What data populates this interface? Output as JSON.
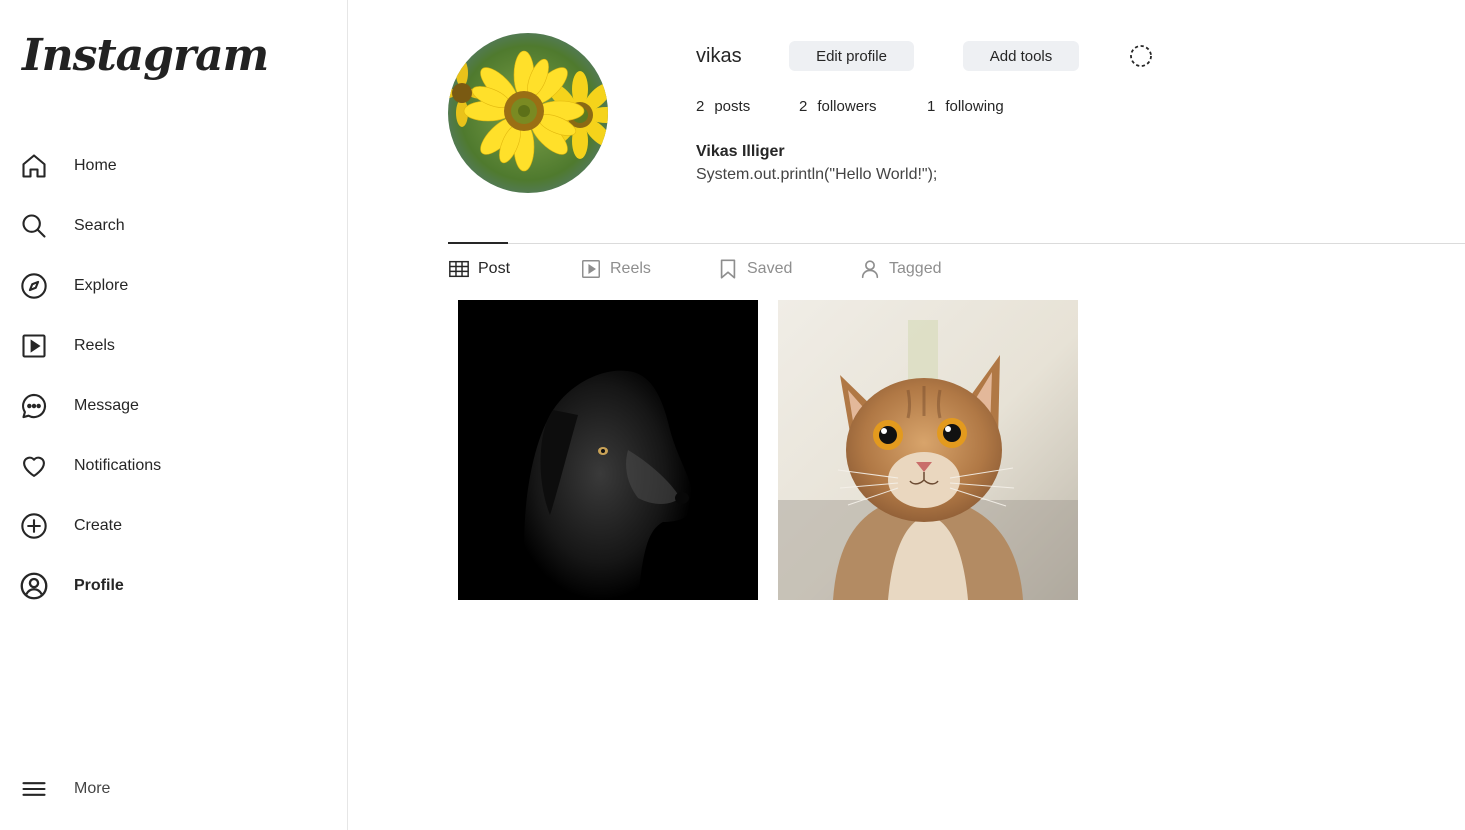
{
  "sidebar": {
    "logo": "Instagram",
    "items": [
      {
        "label": "Home",
        "icon": "home-icon"
      },
      {
        "label": "Search",
        "icon": "search-icon"
      },
      {
        "label": "Explore",
        "icon": "compass-icon"
      },
      {
        "label": "Reels",
        "icon": "reels-icon"
      },
      {
        "label": "Message",
        "icon": "message-icon"
      },
      {
        "label": "Notifications",
        "icon": "heart-icon"
      },
      {
        "label": "Create",
        "icon": "plus-circle-icon"
      },
      {
        "label": "Profile",
        "icon": "profile-icon"
      }
    ],
    "more": {
      "label": "More",
      "icon": "menu-icon"
    }
  },
  "profile": {
    "username": "vikas",
    "edit_label": "Edit profile",
    "tools_label": "Add tools",
    "stats": {
      "posts": {
        "count": "2",
        "label": "posts"
      },
      "followers": {
        "count": "2",
        "label": "followers"
      },
      "following": {
        "count": "1",
        "label": "following"
      }
    },
    "full_name": "Vikas Illiger",
    "bio": "System.out.println(\"Hello World!\");"
  },
  "tabs": [
    {
      "label": "Post",
      "icon": "grid-icon",
      "active": true
    },
    {
      "label": "Reels",
      "icon": "reels-icon",
      "active": false
    },
    {
      "label": "Saved",
      "icon": "bookmark-icon",
      "active": false
    },
    {
      "label": "Tagged",
      "icon": "person-icon",
      "active": false
    }
  ],
  "posts": [
    {
      "subject": "dog-photo"
    },
    {
      "subject": "cat-photo"
    }
  ],
  "colors": {
    "text": "#262626",
    "muted": "#8e8e8e",
    "button_bg": "#eef0f3",
    "divider": "#dbdbdb"
  }
}
